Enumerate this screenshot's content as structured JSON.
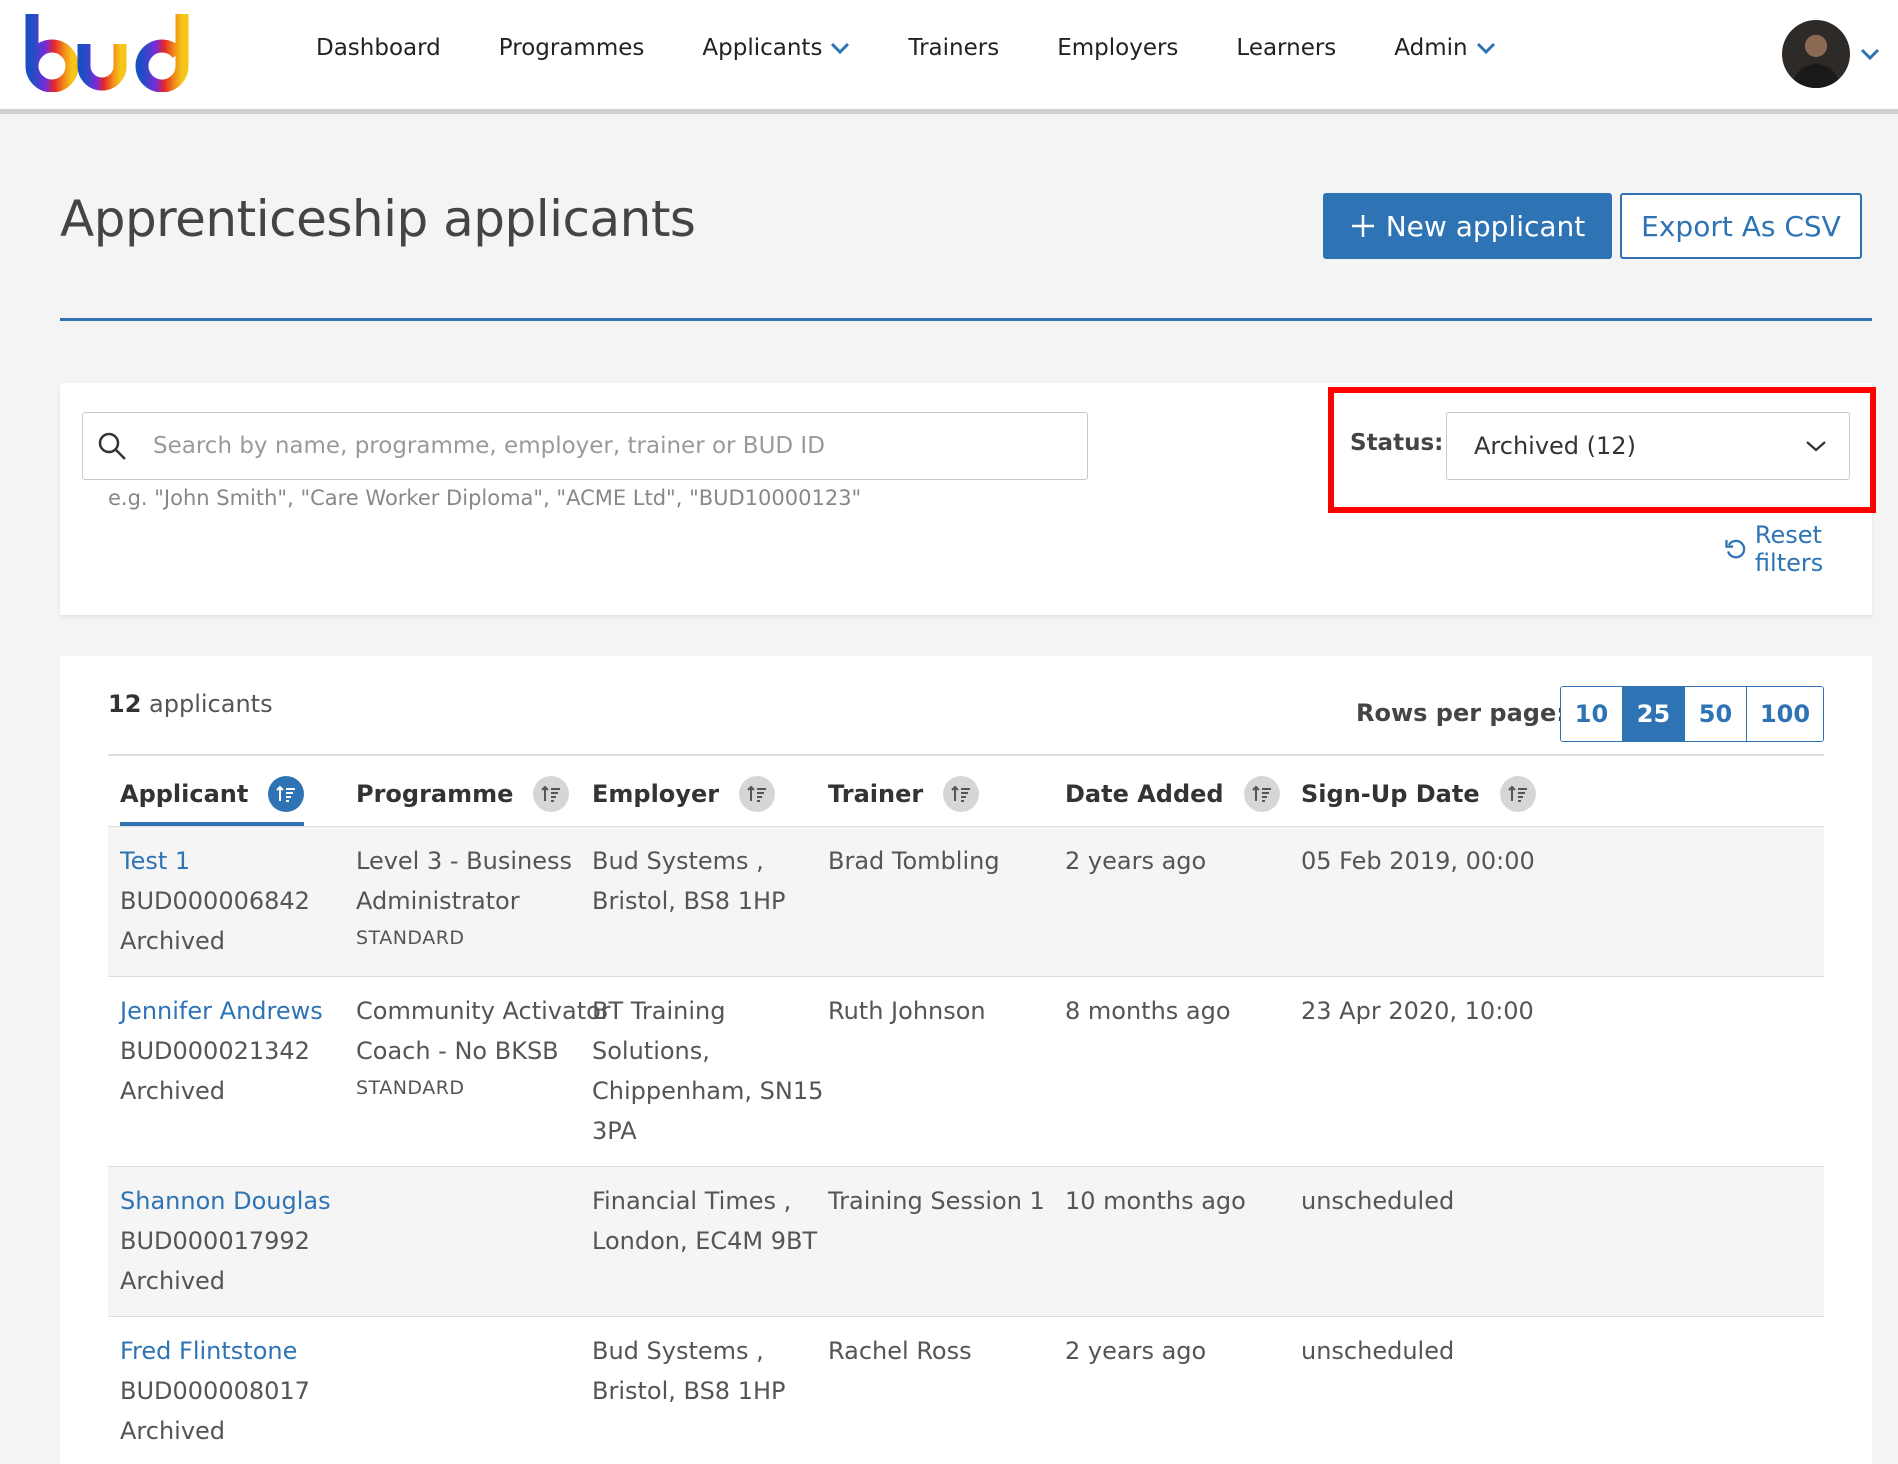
{
  "nav": {
    "items": [
      {
        "label": "Dashboard",
        "dropdown": false
      },
      {
        "label": "Programmes",
        "dropdown": false
      },
      {
        "label": "Applicants",
        "dropdown": true
      },
      {
        "label": "Trainers",
        "dropdown": false
      },
      {
        "label": "Employers",
        "dropdown": false
      },
      {
        "label": "Learners",
        "dropdown": false
      },
      {
        "label": "Admin",
        "dropdown": true
      }
    ]
  },
  "header": {
    "title": "Apprenticeship applicants",
    "new_button": "New applicant",
    "export_button": "Export As CSV"
  },
  "filters": {
    "search_placeholder": "Search by name, programme, employer, trainer or BUD ID",
    "search_value": "",
    "search_hint": "e.g. \"John Smith\", \"Care Worker Diploma\", \"ACME Ltd\", \"BUD10000123\"",
    "status_label": "Status:",
    "status_value": "Archived (12)",
    "reset_label": "Reset filters"
  },
  "table": {
    "count_number": "12",
    "count_label": "applicants",
    "rows_label": "Rows per page:",
    "rows_options": [
      "10",
      "25",
      "50",
      "100"
    ],
    "rows_selected": "25",
    "columns": [
      "Applicant",
      "Programme",
      "Employer",
      "Trainer",
      "Date Added",
      "Sign-Up Date"
    ],
    "sorted_column": "Applicant",
    "rows": [
      {
        "name": "Test 1",
        "bud_id": "BUD000006842",
        "status": "Archived",
        "programme": [
          "Level 3 - Business",
          "Administrator"
        ],
        "programme_tag": "STANDARD",
        "employer": [
          "Bud Systems ,",
          "Bristol, BS8 1HP"
        ],
        "trainer": "Brad Tombling",
        "date_added": "2 years ago",
        "signup_date": "05 Feb 2019, 00:00"
      },
      {
        "name": "Jennifer Andrews",
        "bud_id": "BUD000021342",
        "status": "Archived",
        "programme": [
          "Community Activator",
          "Coach - No BKSB"
        ],
        "programme_tag": "STANDARD",
        "employer": [
          "BT Training",
          "Solutions,",
          "Chippenham, SN15",
          "3PA"
        ],
        "trainer": "Ruth Johnson",
        "date_added": "8 months ago",
        "signup_date": "23 Apr 2020, 10:00"
      },
      {
        "name": "Shannon Douglas",
        "bud_id": "BUD000017992",
        "status": "Archived",
        "programme": [],
        "programme_tag": "",
        "employer": [
          "Financial Times ,",
          "London, EC4M 9BT"
        ],
        "trainer": "Training Session 1",
        "date_added": "10 months ago",
        "signup_date": "unscheduled"
      },
      {
        "name": "Fred Flintstone",
        "bud_id": "BUD000008017",
        "status": "Archived",
        "programme": [],
        "programme_tag": "",
        "employer": [
          "Bud Systems ,",
          "Bristol, BS8 1HP"
        ],
        "trainer": "Rachel Ross",
        "date_added": "2 years ago",
        "signup_date": "unscheduled"
      }
    ]
  },
  "colors": {
    "accent": "#2e74b5",
    "highlight": "#ff0000"
  },
  "icons": {
    "search": "search-icon",
    "chevron": "chevron-down-icon",
    "reset": "reset-icon",
    "sort": "sort-icon",
    "plus": "plus-icon"
  }
}
